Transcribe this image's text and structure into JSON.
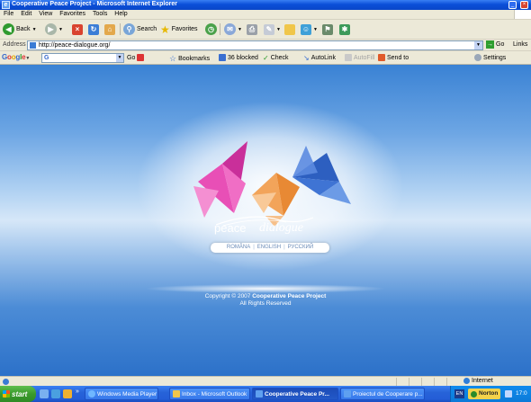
{
  "window": {
    "title": "Cooperative Peace Project - Microsoft Internet Explorer"
  },
  "menu": [
    "File",
    "Edit",
    "View",
    "Favorites",
    "Tools",
    "Help"
  ],
  "toolbar": {
    "back": "Back",
    "search": "Search",
    "favorites": "Favorites"
  },
  "address": {
    "label": "Address",
    "url": "http://peace-dialogue.org/",
    "go": "Go",
    "links": "Links"
  },
  "google_toolbar": {
    "logo": "Google",
    "search_value": "G",
    "go": "Go",
    "bookmarks": "Bookmarks",
    "blocked": "36 blocked",
    "check": "Check",
    "autolink": "AutoLink",
    "autofill": "AutoFill",
    "send_to": "Send to",
    "settings": "Settings"
  },
  "page": {
    "logo_peace": "peace",
    "logo_dialogue": "dialogue",
    "languages": [
      "ROMÂNA",
      "ENGLISH",
      "РУССКИЙ"
    ],
    "copyright_prefix": "Copyright © 2007",
    "copyright_org": "Cooperative Peace Project",
    "copyright_rights": "All Rights Reserved"
  },
  "statusbar": {
    "zone": "Internet"
  },
  "taskbar": {
    "start": "start",
    "tasks": [
      "Windows Media Player",
      "Inbox - Microsoft Outlook",
      "Cooperative Peace Pr...",
      "Proiectul de Cooperare p..."
    ],
    "language": "EN",
    "norton": "Norton",
    "clock": "17:0"
  },
  "colors": {
    "title_bar": "#0b4fd8",
    "chrome": "#ece9d8",
    "page_blue": "#2c71c9",
    "taskbar": "#245dd7",
    "start_green": "#3a9a2c",
    "crane_pink": "#e84fb6",
    "crane_orange": "#f2a45a",
    "crane_blue": "#3f74d4"
  }
}
